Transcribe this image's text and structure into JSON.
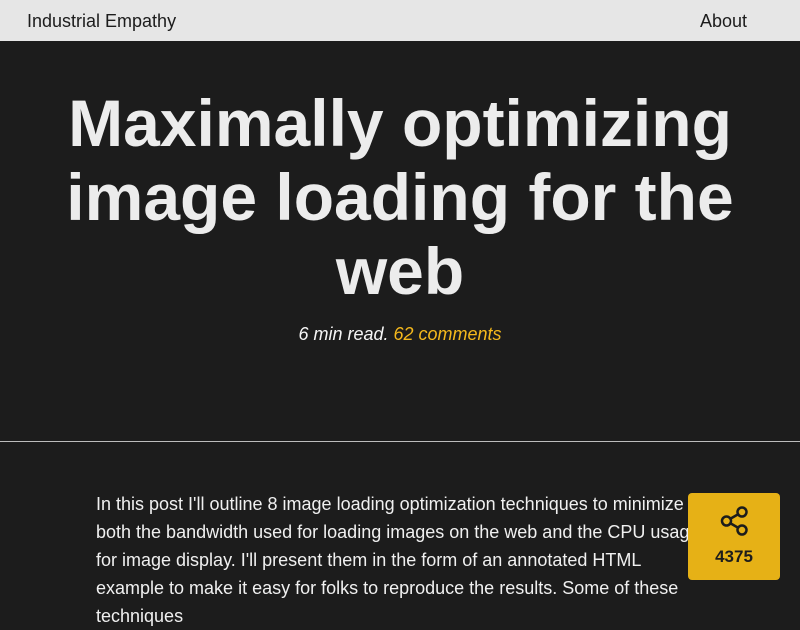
{
  "header": {
    "site_title": "Industrial Empathy",
    "nav_about": "About"
  },
  "article": {
    "title": "Maximally optimizing image loading for the web",
    "read_time": "6 min read.",
    "comments": "62 comments",
    "intro": "In this post I'll outline 8 image loading optimization techniques to minimize both the bandwidth used for loading images on the web and the CPU usage for image display. I'll present them in the form of an annotated HTML example to make it easy for folks to reproduce the results. Some of these techniques"
  },
  "share": {
    "icon": "share-icon",
    "count": "4375"
  },
  "colors": {
    "background": "#1c1c1c",
    "header_background": "#e6e6e6",
    "accent": "#f4b81c",
    "share_background": "#e6b116",
    "text": "#ececec"
  }
}
